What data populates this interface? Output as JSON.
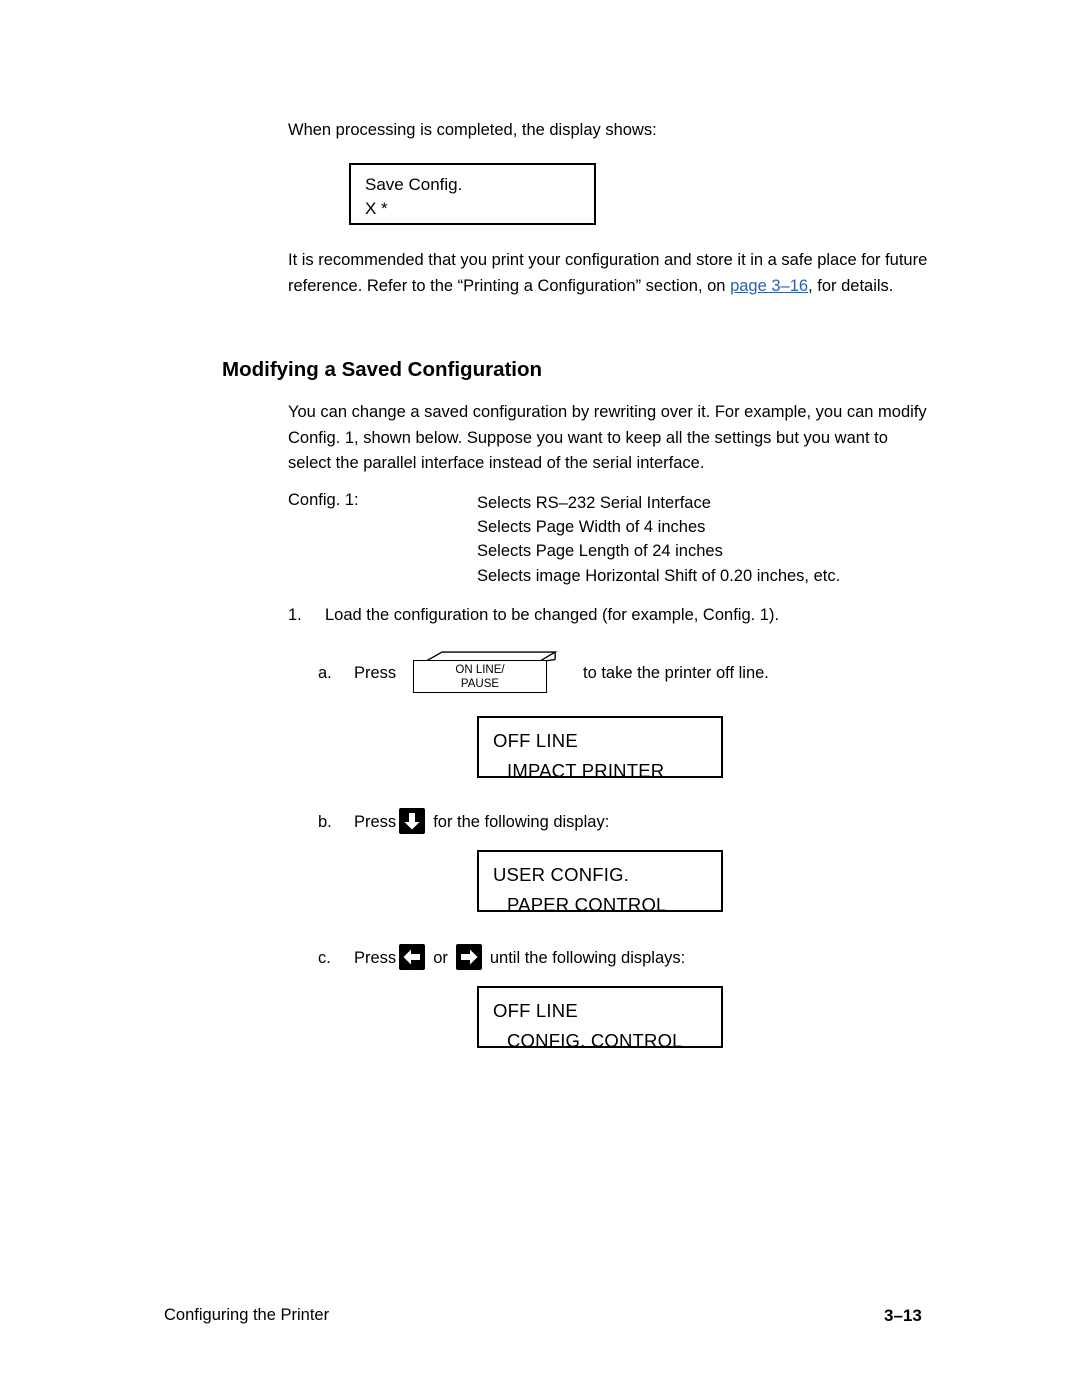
{
  "body": {
    "intro_line": "When processing is completed, the display shows:",
    "recommend_para_part1": "It is recommended that you print your configuration and store it in a safe place for future reference. Refer to the “Printing a Configuration” section, on ",
    "recommend_link": "page 3–16",
    "recommend_para_part2": ", for details.",
    "section_heading": "Modifying a Saved Configuration",
    "modify_para": "You can change a saved configuration by rewriting over it. For example, you can modify Config. 1, shown below. Suppose you want to keep all the settings but you want to select the parallel interface instead of the serial interface.",
    "config_label": "Config. 1:",
    "config_items": [
      "Selects RS–232 Serial Interface",
      "Selects Page Width of 4 inches",
      "Selects Page Length of 24 inches",
      "Selects image Horizontal Shift of 0.20 inches, etc."
    ],
    "step_1_number": "1.",
    "step_1_text": "Load the configuration to be changed (for example, Config. 1).",
    "step_a_letter": "a.",
    "step_a_press": "Press",
    "step_a_after": "to take the printer off line.",
    "step_b_letter": "b.",
    "step_b_press": "Press",
    "step_b_after": "for the following display:",
    "step_c_letter": "c.",
    "step_c_press": "Press",
    "step_c_or": "or",
    "step_c_after": "until the following displays:"
  },
  "displays": {
    "save_config": {
      "line1": "Save Config.",
      "line2": "X *"
    },
    "off_line_impact": {
      "line1": "OFF LINE",
      "line2": "IMPACT PRINTER"
    },
    "user_config_paper": {
      "line1": "USER CONFIG.",
      "line2": "PAPER CONTROL"
    },
    "off_line_config": {
      "line1": "OFF LINE",
      "line2": "CONFIG. CONTROL"
    }
  },
  "keys": {
    "online_pause_line1": "ON LINE/",
    "online_pause_line2": "PAUSE",
    "down_icon": "down-arrow-key-icon",
    "left_icon": "left-arrow-key-icon",
    "right_icon": "right-arrow-key-icon"
  },
  "footer": {
    "left": "Configuring the Printer",
    "right": "3–13"
  }
}
